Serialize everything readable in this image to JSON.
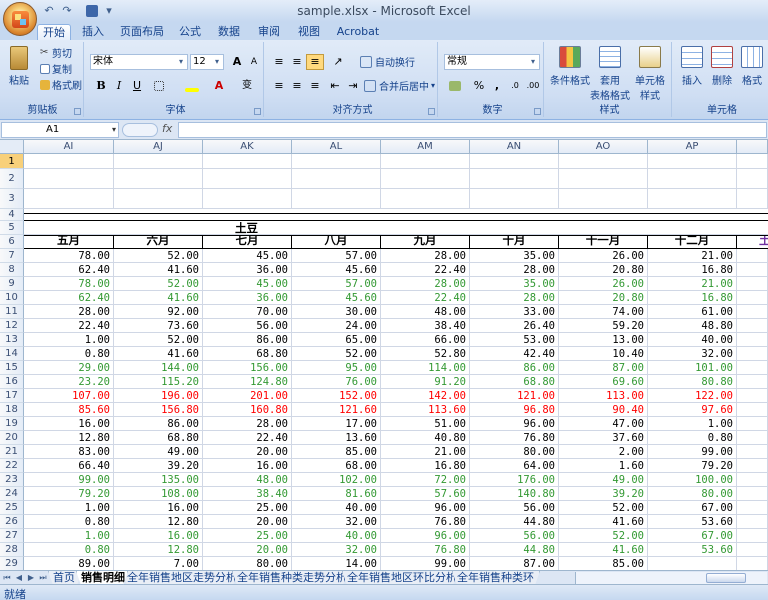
{
  "window": {
    "title": "sample.xlsx - Microsoft Excel"
  },
  "tabs": [
    {
      "label": "开始",
      "active": true
    },
    {
      "label": "插入"
    },
    {
      "label": "页面布局"
    },
    {
      "label": "公式"
    },
    {
      "label": "数据"
    },
    {
      "label": "审阅"
    },
    {
      "label": "视图"
    },
    {
      "label": "Acrobat"
    }
  ],
  "ribbon": {
    "clipboard": {
      "label": "剪贴板",
      "paste": "粘贴",
      "cut": "剪切",
      "copy": "复制",
      "format_painter": "格式刷"
    },
    "font": {
      "label": "字体",
      "name": "宋体",
      "size": "12",
      "bold": "B",
      "italic": "I",
      "underline": "U",
      "grow": "A",
      "shrink": "A",
      "pinyin": "变"
    },
    "alignment": {
      "label": "对齐方式",
      "wrap": "自动换行",
      "merge": "合并后居中"
    },
    "number": {
      "label": "数字",
      "format": "常规",
      "percent": "%",
      "comma": ","
    },
    "styles": {
      "label": "样式",
      "conditional": "条件格式",
      "table1": "套用",
      "table2": "表格格式",
      "cell1": "单元格",
      "cell2": "样式"
    },
    "cells": {
      "label": "单元格",
      "insert": "插入",
      "delete": "删除",
      "format": "格式"
    }
  },
  "formula_bar": {
    "name_box": "A1",
    "fx": "fx",
    "value": ""
  },
  "columns": [
    "AI",
    "AJ",
    "AK",
    "AL",
    "AM",
    "AN",
    "AO",
    "AP"
  ],
  "row_numbers": [
    "1",
    "2",
    "3",
    "4",
    "5",
    "6",
    "7",
    "8",
    "9",
    "10",
    "11",
    "12",
    "13",
    "14",
    "15",
    "16",
    "17",
    "18",
    "19",
    "20",
    "21",
    "22",
    "23",
    "24",
    "25",
    "26",
    "27",
    "28",
    "29"
  ],
  "product_label": "土豆",
  "month_headers": [
    "五月",
    "六月",
    "七月",
    "八月",
    "九月",
    "十月",
    "十一月",
    "十二月"
  ],
  "partial_next_header": "土",
  "data_colors": {
    "black": "#000000",
    "green": "#339933",
    "red": "#ff0000"
  },
  "data_rows": [
    {
      "color": "black",
      "values": [
        "78.00",
        "52.00",
        "45.00",
        "57.00",
        "28.00",
        "35.00",
        "26.00",
        "21.00"
      ]
    },
    {
      "color": "black",
      "values": [
        "62.40",
        "41.60",
        "36.00",
        "45.60",
        "22.40",
        "28.00",
        "20.80",
        "16.80"
      ]
    },
    {
      "color": "green",
      "values": [
        "78.00",
        "52.00",
        "45.00",
        "57.00",
        "28.00",
        "35.00",
        "26.00",
        "21.00"
      ]
    },
    {
      "color": "green",
      "values": [
        "62.40",
        "41.60",
        "36.00",
        "45.60",
        "22.40",
        "28.00",
        "20.80",
        "16.80"
      ]
    },
    {
      "color": "black",
      "values": [
        "28.00",
        "92.00",
        "70.00",
        "30.00",
        "48.00",
        "33.00",
        "74.00",
        "61.00"
      ]
    },
    {
      "color": "black",
      "values": [
        "22.40",
        "73.60",
        "56.00",
        "24.00",
        "38.40",
        "26.40",
        "59.20",
        "48.80"
      ]
    },
    {
      "color": "black",
      "values": [
        "1.00",
        "52.00",
        "86.00",
        "65.00",
        "66.00",
        "53.00",
        "13.00",
        "40.00"
      ]
    },
    {
      "color": "black",
      "values": [
        "0.80",
        "41.60",
        "68.80",
        "52.00",
        "52.80",
        "42.40",
        "10.40",
        "32.00"
      ]
    },
    {
      "color": "green",
      "values": [
        "29.00",
        "144.00",
        "156.00",
        "95.00",
        "114.00",
        "86.00",
        "87.00",
        "101.00"
      ]
    },
    {
      "color": "green",
      "values": [
        "23.20",
        "115.20",
        "124.80",
        "76.00",
        "91.20",
        "68.80",
        "69.60",
        "80.80"
      ]
    },
    {
      "color": "red",
      "values": [
        "107.00",
        "196.00",
        "201.00",
        "152.00",
        "142.00",
        "121.00",
        "113.00",
        "122.00"
      ]
    },
    {
      "color": "red",
      "values": [
        "85.60",
        "156.80",
        "160.80",
        "121.60",
        "113.60",
        "96.80",
        "90.40",
        "97.60"
      ]
    },
    {
      "color": "black",
      "values": [
        "16.00",
        "86.00",
        "28.00",
        "17.00",
        "51.00",
        "96.00",
        "47.00",
        "1.00"
      ]
    },
    {
      "color": "black",
      "values": [
        "12.80",
        "68.80",
        "22.40",
        "13.60",
        "40.80",
        "76.80",
        "37.60",
        "0.80"
      ]
    },
    {
      "color": "black",
      "values": [
        "83.00",
        "49.00",
        "20.00",
        "85.00",
        "21.00",
        "80.00",
        "2.00",
        "99.00"
      ]
    },
    {
      "color": "black",
      "values": [
        "66.40",
        "39.20",
        "16.00",
        "68.00",
        "16.80",
        "64.00",
        "1.60",
        "79.20"
      ]
    },
    {
      "color": "green",
      "values": [
        "99.00",
        "135.00",
        "48.00",
        "102.00",
        "72.00",
        "176.00",
        "49.00",
        "100.00"
      ]
    },
    {
      "color": "green",
      "values": [
        "79.20",
        "108.00",
        "38.40",
        "81.60",
        "57.60",
        "140.80",
        "39.20",
        "80.00"
      ]
    },
    {
      "color": "black",
      "values": [
        "1.00",
        "16.00",
        "25.00",
        "40.00",
        "96.00",
        "56.00",
        "52.00",
        "67.00"
      ]
    },
    {
      "color": "black",
      "values": [
        "0.80",
        "12.80",
        "20.00",
        "32.00",
        "76.80",
        "44.80",
        "41.60",
        "53.60"
      ]
    },
    {
      "color": "green",
      "values": [
        "1.00",
        "16.00",
        "25.00",
        "40.00",
        "96.00",
        "56.00",
        "52.00",
        "67.00"
      ]
    },
    {
      "color": "green",
      "values": [
        "0.80",
        "12.80",
        "20.00",
        "32.00",
        "76.80",
        "44.80",
        "41.60",
        "53.60"
      ]
    },
    {
      "color": "black",
      "values": [
        "89.00",
        "7.00",
        "80.00",
        "14.00",
        "99.00",
        "87.00",
        "85.00",
        ""
      ]
    }
  ],
  "sheets": [
    {
      "label": "首页"
    },
    {
      "label": "销售明细",
      "active": true
    },
    {
      "label": "全年销售地区走势分析"
    },
    {
      "label": "全年销售种类走势分析"
    },
    {
      "label": "全年销售地区环比分析"
    },
    {
      "label": "全年销售种类环"
    }
  ],
  "status": {
    "text": "就绪"
  }
}
